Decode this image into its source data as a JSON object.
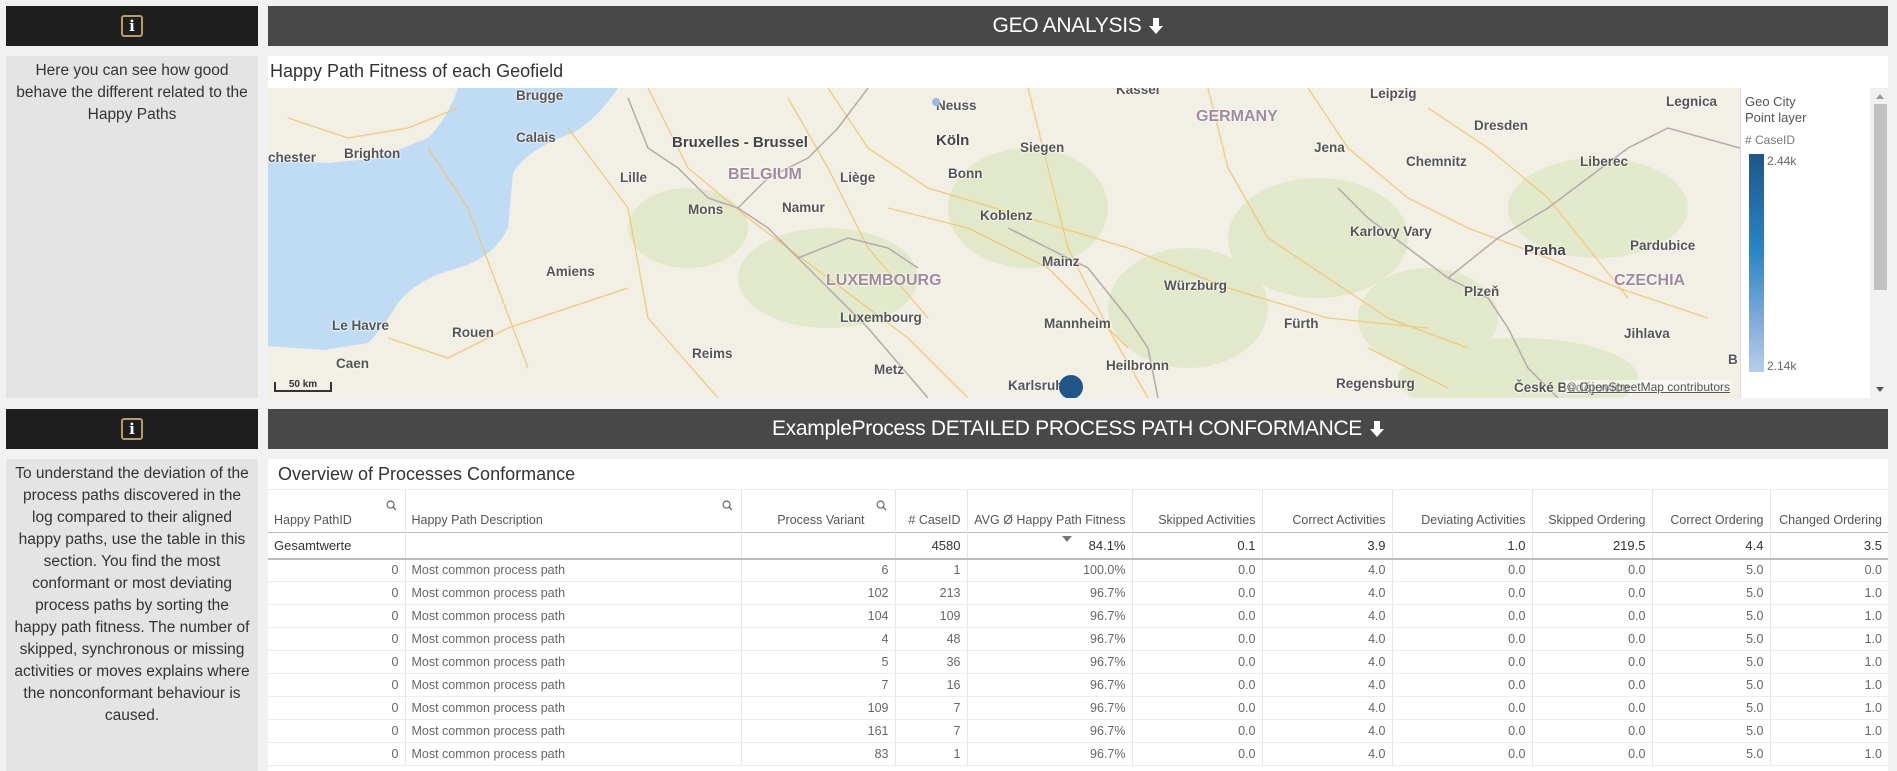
{
  "geo_section": {
    "info_icon": "info-icon",
    "description": "Here you can see how good behave the different related to the Happy Paths",
    "header_title": "GEO ANALYSIS",
    "header_icon": "arrow-down-icon",
    "map_title": "Happy Path Fitness of each Geofield",
    "map": {
      "scale_label": "50 km",
      "attribution": "© OpenStreetMap contributors",
      "countries": [
        "BELGIUM",
        "LUXEMBOURG",
        "GERMANY",
        "CZECHIA"
      ],
      "cities": [
        "Brugge",
        "Calais",
        "Brighton",
        "chester",
        "Bruxelles - Brussel",
        "Lille",
        "Mons",
        "Namur",
        "Liège",
        "Neuss",
        "Köln",
        "Bonn",
        "Siegen",
        "Kassel",
        "Koblenz",
        "Mainz",
        "Luxembourg",
        "Amiens",
        "Le Havre",
        "Rouen",
        "Caen",
        "Reims",
        "Metz",
        "Mannheim",
        "Heilbronn",
        "Karlsruhe",
        "Würzburg",
        "Fürth",
        "Regensburg",
        "Leipzig",
        "Dresden",
        "Jena",
        "Chemnitz",
        "Liberec",
        "Legnica",
        "Karlovy Vary",
        "Praha",
        "Plzeň",
        "Pardubice",
        "Jihlava",
        "České Budějovice",
        "B"
      ],
      "points": [
        {
          "location": "Karlsruhe",
          "cases": "2.44k",
          "color": "#1f5688"
        },
        {
          "location": "Neuss",
          "cases": "2.14k",
          "color": "#9db8e2"
        }
      ]
    },
    "legend": {
      "title_line1": "Geo City",
      "title_line2": "Point layer",
      "measure": "# CaseID",
      "max_label": "2.44k",
      "min_label": "2.14k",
      "color_max": "#1f5688",
      "color_min": "#b8cdeb"
    }
  },
  "conformance_section": {
    "info_icon": "info-icon",
    "description": "To understand the deviation of the process paths discovered in the log compared to their aligned happy paths, use the table in this section. You find the most conformant or most deviating process paths by sorting the happy path fitness. The number of skipped, synchronous or missing activities or moves explains where the nonconformant behaviour is caused.",
    "header_title": "ExampleProcess DETAILED PROCESS PATH CONFORMANCE",
    "header_icon": "arrow-down-icon",
    "table_title": "Overview of Processes Conformance",
    "table": {
      "columns": [
        "Happy PathID",
        "Happy Path Description",
        "Process Variant",
        "# CaseID",
        "AVG Ø Happy Path Fitness",
        "Skipped Activities",
        "Correct Activities",
        "Deviating Activities",
        "Skipped Ordering",
        "Correct Ordering",
        "Changed Ordering"
      ],
      "sorted_column": "AVG Ø Happy Path Fitness",
      "sort_direction": "descending",
      "totals": [
        "Gesamtwerte",
        "",
        "",
        "4580",
        "84.1%",
        "0.1",
        "3.9",
        "1.0",
        "219.5",
        "4.4",
        "3.5"
      ],
      "rows": [
        [
          "0",
          "Most common process path",
          "6",
          "1",
          "100.0%",
          "0.0",
          "4.0",
          "0.0",
          "0.0",
          "5.0",
          "0.0"
        ],
        [
          "0",
          "Most common process path",
          "102",
          "213",
          "96.7%",
          "0.0",
          "4.0",
          "0.0",
          "0.0",
          "5.0",
          "1.0"
        ],
        [
          "0",
          "Most common process path",
          "104",
          "109",
          "96.7%",
          "0.0",
          "4.0",
          "0.0",
          "0.0",
          "5.0",
          "1.0"
        ],
        [
          "0",
          "Most common process path",
          "4",
          "48",
          "96.7%",
          "0.0",
          "4.0",
          "0.0",
          "0.0",
          "5.0",
          "1.0"
        ],
        [
          "0",
          "Most common process path",
          "5",
          "36",
          "96.7%",
          "0.0",
          "4.0",
          "0.0",
          "0.0",
          "5.0",
          "1.0"
        ],
        [
          "0",
          "Most common process path",
          "7",
          "16",
          "96.7%",
          "0.0",
          "4.0",
          "0.0",
          "0.0",
          "5.0",
          "1.0"
        ],
        [
          "0",
          "Most common process path",
          "109",
          "7",
          "96.7%",
          "0.0",
          "4.0",
          "0.0",
          "0.0",
          "5.0",
          "1.0"
        ],
        [
          "0",
          "Most common process path",
          "161",
          "7",
          "96.7%",
          "0.0",
          "4.0",
          "0.0",
          "0.0",
          "5.0",
          "1.0"
        ],
        [
          "0",
          "Most common process path",
          "83",
          "1",
          "96.7%",
          "0.0",
          "4.0",
          "0.0",
          "0.0",
          "5.0",
          "1.0"
        ]
      ]
    }
  }
}
